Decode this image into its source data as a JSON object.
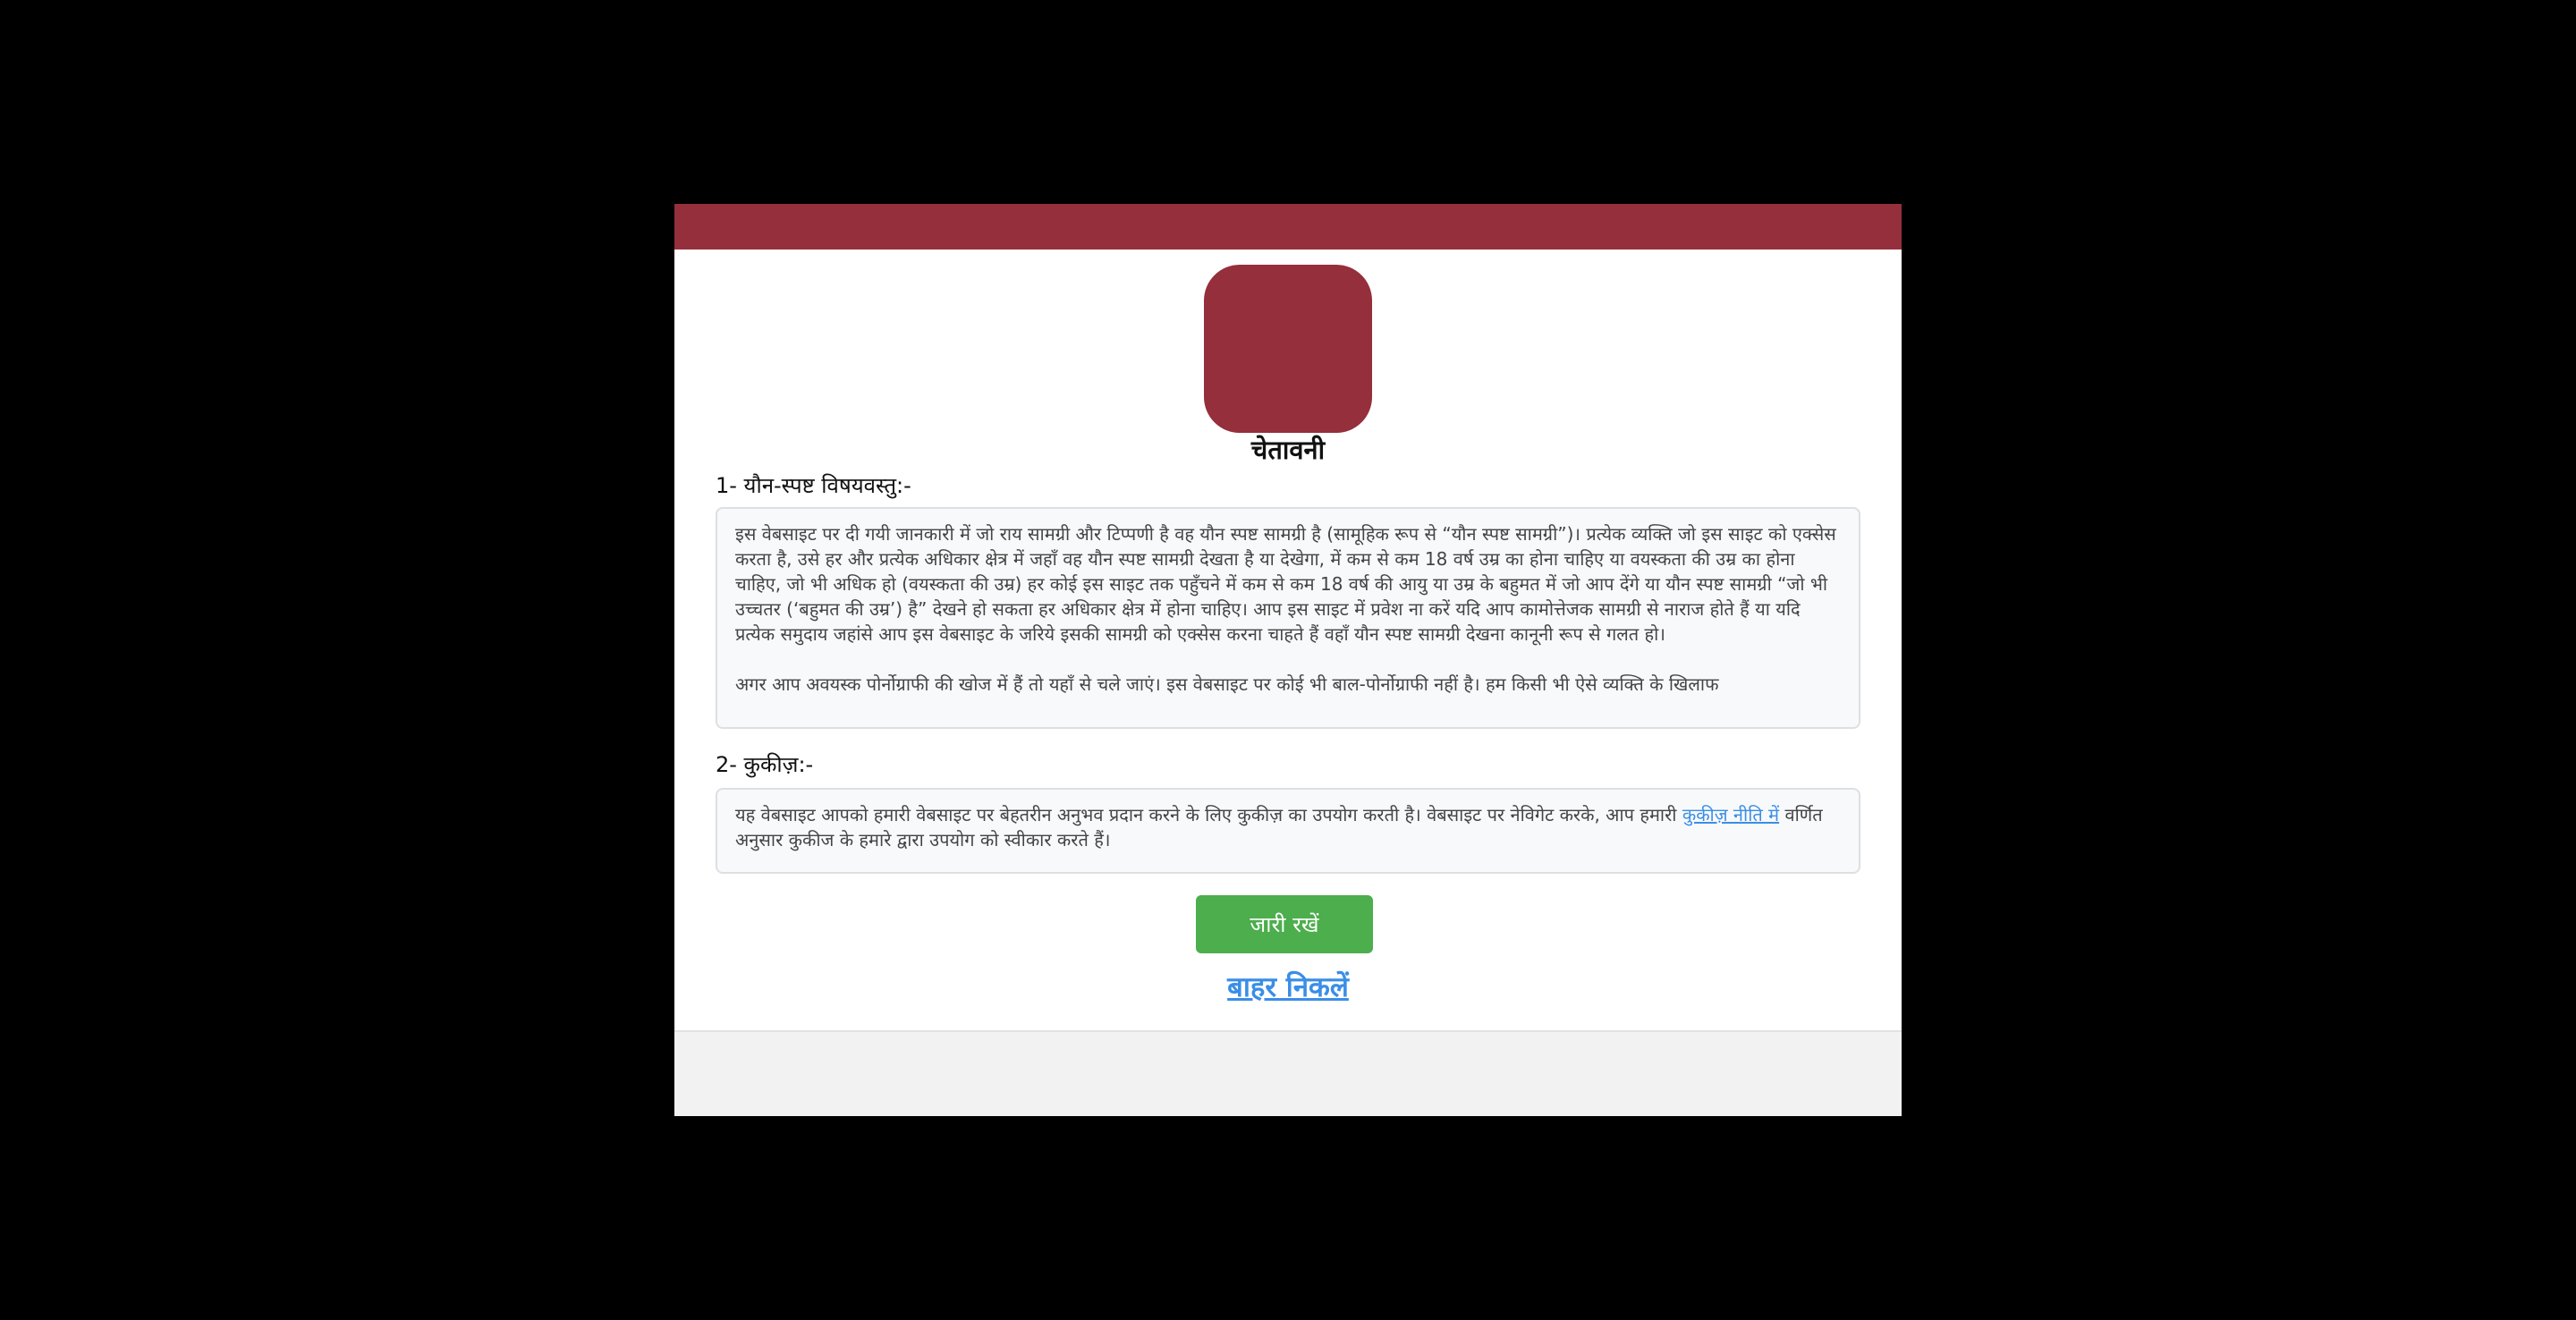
{
  "colors": {
    "backdrop": "#000000",
    "brand": "#952f3b",
    "continue_button": "#4cae4c",
    "link": "#3a8ee6",
    "footer": "#f2f2f2"
  },
  "modal": {
    "title": "चेतावनी",
    "section1": {
      "heading": "1- यौन-स्पष्ट विषयवस्तु:-",
      "paragraph1": "इस वेबसाइट पर दी गयी जानकारी में जो राय सामग्री और टिप्पणी है वह यौन स्पष्ट सामग्री है (सामूहिक रूप से “यौन स्पष्ट सामग्री”)। प्रत्येक व्यक्ति जो इस साइट को एक्सेस करता है, उसे हर और प्रत्येक अधिकार क्षेत्र में जहाँ वह यौन स्पष्ट सामग्री देखता है या देखेगा, में कम से कम 18 वर्ष उम्र का होना चाहिए या वयस्कता की उम्र का होना चाहिए, जो भी अधिक हो (वयस्कता की उम्र) हर कोई इस साइट तक पहुँचने में कम से कम 18 वर्ष की आयु या उम्र के बहुमत में जो आप देंगे या यौन स्पष्ट सामग्री “जो भी उच्चतर (‘बहुमत की उम्र’) है” देखने हो सकता हर अधिकार क्षेत्र में होना चाहिए। आप इस साइट में प्रवेश ना करें यदि आप कामोत्तेजक सामग्री से नाराज होते हैं या यदि प्रत्येक समुदाय जहांसे आप इस वेबसाइट के जरिये इसकी सामग्री को एक्सेस करना चाहते हैं वहाँ यौन स्पष्ट सामग्री देखना कानूनी रूप से गलत हो।",
      "paragraph2": "अगर आप अवयस्क पोर्नोग्राफी की खोज में हैं तो यहाँ से चले जाएं। इस वेबसाइट पर कोई भी बाल-पोर्नोग्राफी नहीं है। हम किसी भी ऐसे व्यक्ति के खिलाफ"
    },
    "section2": {
      "heading": "2- कुकीज़:-",
      "text_before_link": "यह वेबसाइट आपको हमारी वेबसाइट पर बेहतरीन अनुभव प्रदान करने के लिए कुकीज़ का उपयोग करती है। वेबसाइट पर नेविगेट करके, आप हमारी ",
      "link_text": "कुकीज़ नीति में",
      "text_after_link": " वर्णित अनुसार कुकीज के हमारे द्वारा उपयोग को स्वीकार करते हैं।"
    },
    "continue_label": "जारी रखें",
    "exit_label": "बाहर निकलें"
  }
}
